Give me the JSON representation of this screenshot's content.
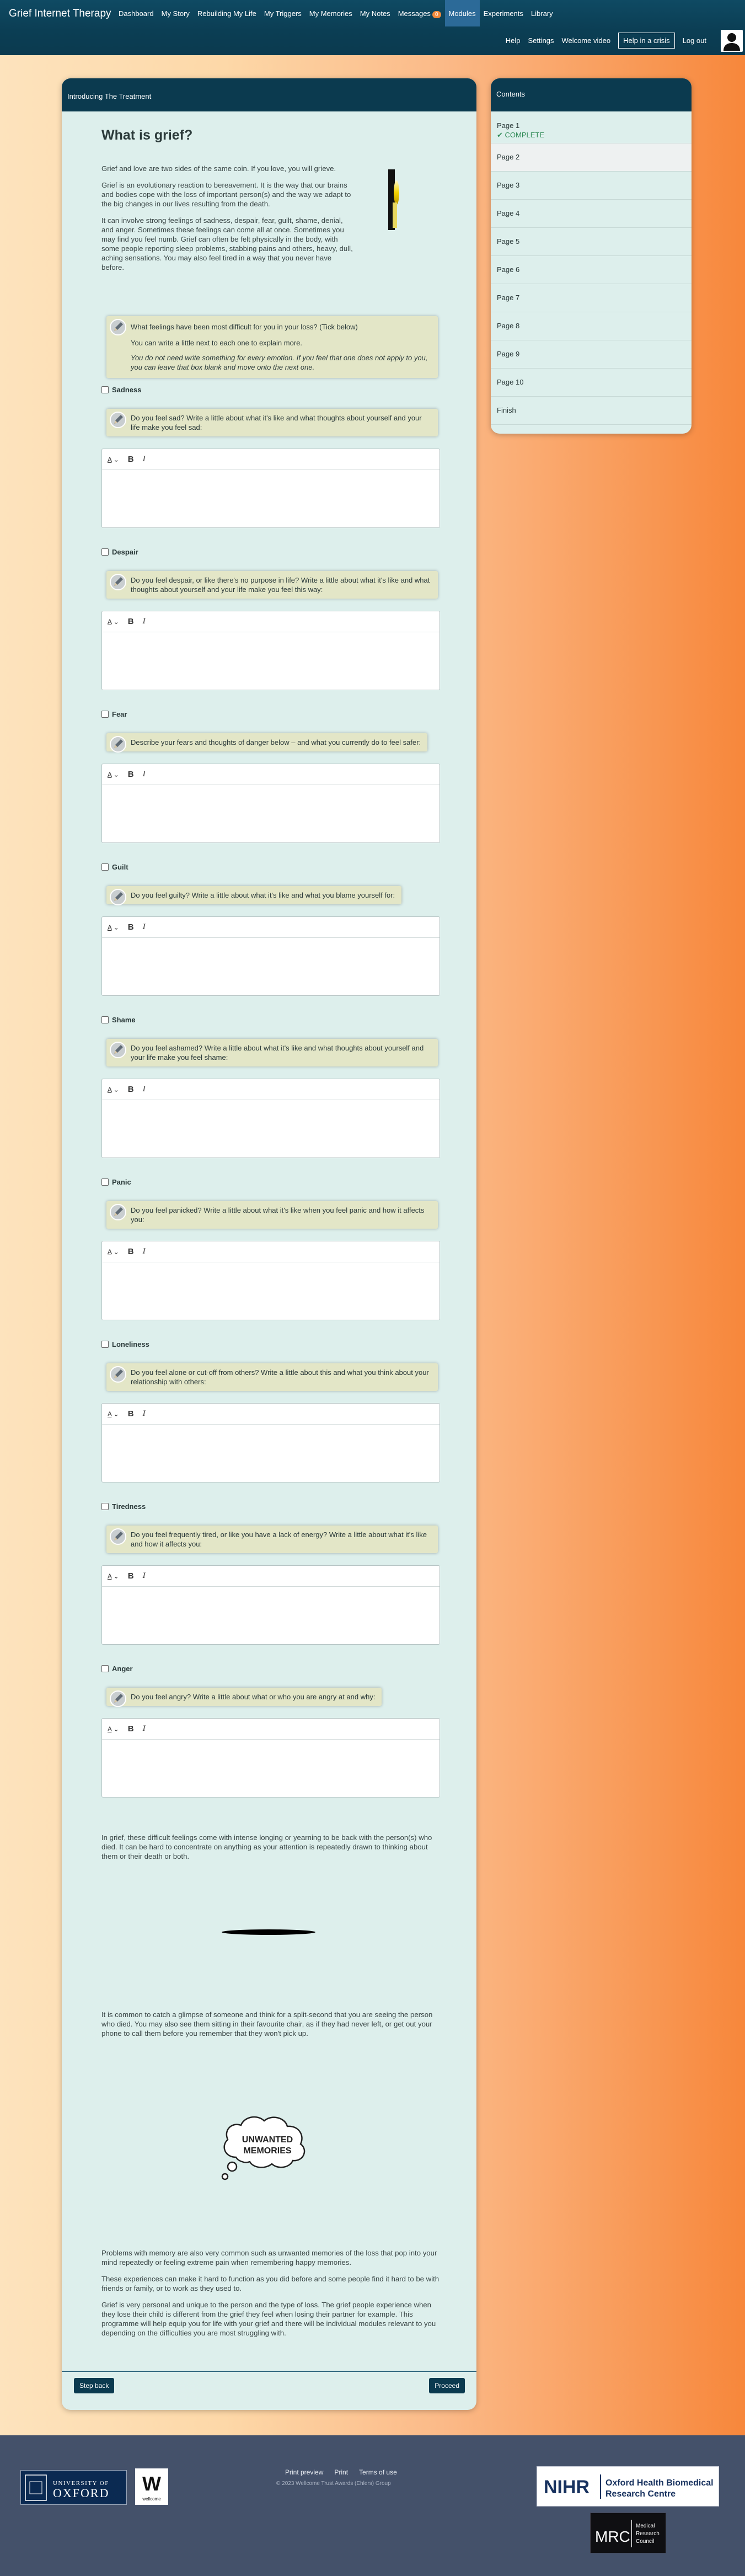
{
  "header": {
    "brand": "Grief Internet Therapy",
    "nav": [
      {
        "label": "Dashboard"
      },
      {
        "label": "My Story"
      },
      {
        "label": "Rebuilding My Life"
      },
      {
        "label": "My Triggers"
      },
      {
        "label": "My Memories"
      },
      {
        "label": "My Notes"
      },
      {
        "label": "Messages",
        "badge": "0"
      },
      {
        "label": "Modules",
        "active": true
      },
      {
        "label": "Experiments"
      },
      {
        "label": "Library"
      }
    ],
    "subnav": {
      "help": "Help",
      "settings": "Settings",
      "welcome": "Welcome video",
      "crisis": "Help in a crisis",
      "logout": "Log out"
    },
    "user_icon": "user-avatar-icon"
  },
  "card": {
    "header": "Introducing The Treatment",
    "title": "What is grief?",
    "intro": [
      "Grief and love are two sides of the same coin. If you love, you will grieve.",
      "Grief is an evolutionary reaction to bereavement. It is the way that our brains and bodies cope with the loss of important person(s) and the way we adapt to the big changes in our lives resulting from the death.",
      "It can involve strong feelings of sadness, despair, fear, guilt, shame, denial, and anger. Sometimes these feelings can come all at once. Sometimes you may find you feel numb. Grief can often be felt physically in the body, with some people reporting sleep problems, stabbing pains and others, heavy, dull, aching sensations. You may also feel tired in a way that you never have before."
    ],
    "question": {
      "main": "What feelings have been most difficult for you in your loss? (Tick below)",
      "hint": "You can write a little next to each one to explain more.",
      "note": "You do not need write something for every emotion. If you feel that one does not apply to you, you can leave that box blank and move onto the next one."
    },
    "emotions": [
      {
        "label": "Sadness",
        "prompt": "Do you feel sad? Write a little about what it's like and what thoughts about yourself and your life make you feel sad:"
      },
      {
        "label": "Despair",
        "prompt": "Do you feel despair, or like there's no purpose in life? Write a little about what it's like and what thoughts about yourself and your life make you feel this way:"
      },
      {
        "label": "Fear",
        "prompt": "Describe your fears and thoughts of danger below – and what you currently do to feel safer:"
      },
      {
        "label": "Guilt",
        "prompt": "Do you feel guilty? Write a little about what it's like and what you blame yourself for:"
      },
      {
        "label": "Shame",
        "prompt": "Do you feel ashamed? Write a little about what it's like and what thoughts about yourself and your life make you feel shame:"
      },
      {
        "label": "Panic",
        "prompt": "Do you feel panicked? Write a little about what it's like when you feel panic and how it affects you:"
      },
      {
        "label": "Loneliness",
        "prompt": "Do you feel alone or cut-off from others? Write a little about this and what you think about your relationship with others:"
      },
      {
        "label": "Tiredness",
        "prompt": "Do you feel frequently tired, or like you have a lack of energy? Write a little about what it's like and how it affects you:"
      },
      {
        "label": "Anger",
        "prompt": "Do you feel angry? Write a little about what or who you are angry at and why:"
      }
    ],
    "editor_tools": {
      "bold": "B",
      "italic": "I",
      "highlight": "A"
    },
    "outro1": "In grief, these difficult feelings come with intense longing or yearning to be back with the person(s) who died. It can be hard to concentrate on anything as your attention is repeatedly drawn to thinking about them or their death or both.",
    "outro2": "It is common to catch a glimpse of someone and think for a split-second that you are seeing the person who died. You may also see them sitting in their favourite chair, as if they had never left, or get out your phone to call them before you remember that they won't pick up.",
    "memories_text": [
      "UNWANTED",
      "MEMORIES"
    ],
    "outro3": "Problems with memory are also very common such as unwanted memories of the loss that pop into your mind repeatedly or feeling extreme pain when remembering happy memories.",
    "outro4": "These experiences can make it hard to function as you did before and some people find it hard to be with friends or family, or to work as they used to.",
    "outro5": "Grief is very personal and unique to the person and the type of loss. The grief people experience when they lose their child is different from the grief they feel when losing their partner for example. This programme will help equip you for life with your grief and there will be individual modules relevant to you depending on the difficulties you are most struggling with.",
    "btn_back": "Step back",
    "btn_next": "Proceed"
  },
  "contents": {
    "header": "Contents",
    "items": [
      {
        "label": "Page 1",
        "status": "COMPLETE"
      },
      {
        "label": "Page 2"
      },
      {
        "label": "Page 3"
      },
      {
        "label": "Page 4"
      },
      {
        "label": "Page 5"
      },
      {
        "label": "Page 6"
      },
      {
        "label": "Page 7"
      },
      {
        "label": "Page 8"
      },
      {
        "label": "Page 9"
      },
      {
        "label": "Page 10"
      },
      {
        "label": "Finish"
      }
    ]
  },
  "footer": {
    "links": [
      "Print preview",
      "Print",
      "Terms of use"
    ],
    "copyright": "© 2023 Wellcome Trust Awards (Ehlers) Group",
    "logos": {
      "oxford": [
        "UNIVERSITY OF",
        "OXFORD"
      ],
      "wellcome": "wellcome",
      "nihr": [
        "NIHR",
        "Oxford Health Biomedical",
        "Research Centre"
      ],
      "mrc": [
        "MRC",
        "Medical",
        "Research",
        "Council"
      ]
    }
  }
}
